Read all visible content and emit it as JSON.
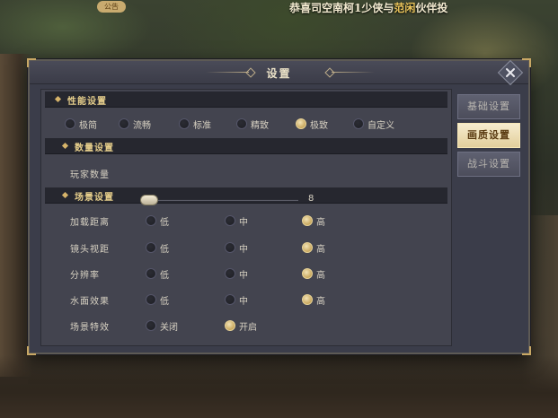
{
  "notice": {
    "badge": "公告",
    "text_before": "恭喜司空南柯1少侠与",
    "highlight": "范闲",
    "text_after": "伙伴投"
  },
  "dialog": {
    "title": "设置",
    "tabs": [
      {
        "label": "基础设置",
        "active": false
      },
      {
        "label": "画质设置",
        "active": true
      },
      {
        "label": "战斗设置",
        "active": false
      }
    ],
    "performance": {
      "title": "性能设置",
      "options": [
        "极简",
        "流畅",
        "标准",
        "精致",
        "极致",
        "自定义"
      ],
      "selected": "极致"
    },
    "quantity": {
      "title": "数量设置",
      "player_count_label": "玩家数量",
      "player_count_value": "8"
    },
    "scene": {
      "title": "场景设置",
      "rows": [
        {
          "label": "加载距离",
          "options": [
            "低",
            "中",
            "高"
          ],
          "selected": "高"
        },
        {
          "label": "镜头视距",
          "options": [
            "低",
            "中",
            "高"
          ],
          "selected": "高"
        },
        {
          "label": "分辨率",
          "options": [
            "低",
            "中",
            "高"
          ],
          "selected": "高"
        },
        {
          "label": "水面效果",
          "options": [
            "低",
            "中",
            "高"
          ],
          "selected": "高"
        },
        {
          "label": "场景特效",
          "options": [
            "关闭",
            "开启"
          ],
          "selected": "开启"
        }
      ]
    }
  },
  "colors": {
    "accent_gold": "#d7b46a",
    "active_tab": "#e3cf9c",
    "panel_bg": "#43444f"
  },
  "icons": {
    "close": "close-icon",
    "section_marker": "diamond-icon"
  }
}
